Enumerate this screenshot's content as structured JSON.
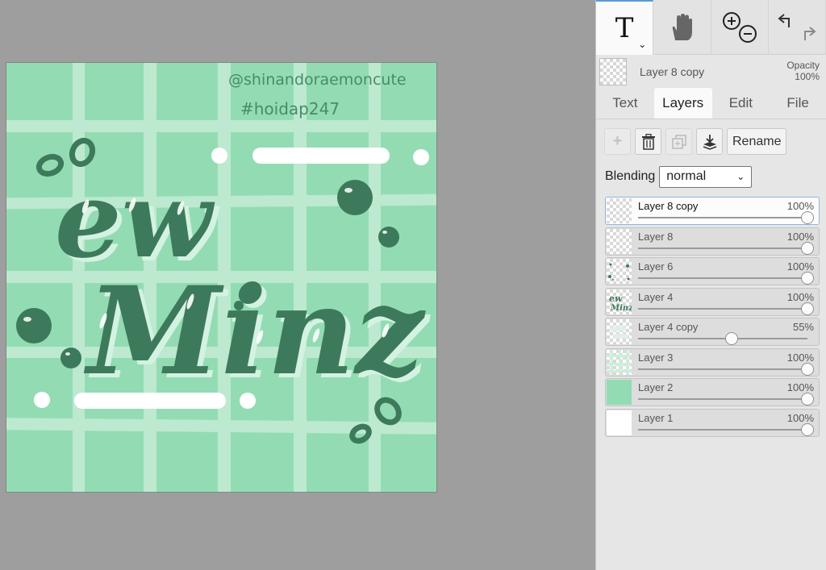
{
  "canvas": {
    "watermark_user": "@shinandoraemoncute",
    "watermark_tag": "#hoidap247",
    "artwork_line1": "ew",
    "artwork_line2": "Minz",
    "colors": {
      "background": "#93dcb3",
      "stripes": "#bfead1",
      "lettering": "#3d7a5b",
      "dots": "#ffffff"
    }
  },
  "toolbar": {
    "tools": [
      {
        "name": "text-tool",
        "label": "T",
        "active": true
      },
      {
        "name": "pan-tool",
        "icon": "hand-icon"
      },
      {
        "name": "zoom-tool",
        "icons": [
          "zoom-in-icon",
          "zoom-out-icon"
        ]
      },
      {
        "name": "history-tool",
        "icons": [
          "undo-icon",
          "redo-icon"
        ]
      }
    ]
  },
  "current_layer": {
    "name": "Layer 8 copy",
    "opacity_label": "Opacity",
    "opacity_value": "100%"
  },
  "tabs": [
    {
      "label": "Text",
      "active": false
    },
    {
      "label": "Layers",
      "active": true
    },
    {
      "label": "Edit",
      "active": false
    },
    {
      "label": "File",
      "active": false
    }
  ],
  "actions": {
    "add_icon": "plus-icon",
    "delete_icon": "trash-icon",
    "duplicate_icon": "duplicate-icon",
    "merge_icon": "merge-down-icon",
    "rename_label": "Rename"
  },
  "blending": {
    "label": "Blending",
    "value": "normal"
  },
  "layers": [
    {
      "name": "Layer 8 copy",
      "opacity": "100%",
      "opacity_fraction": 1.0,
      "selected": true,
      "thumb": "transparent"
    },
    {
      "name": "Layer 8",
      "opacity": "100%",
      "opacity_fraction": 1.0,
      "selected": false,
      "thumb": "transparent"
    },
    {
      "name": "Layer 6",
      "opacity": "100%",
      "opacity_fraction": 1.0,
      "selected": false,
      "thumb": "dots"
    },
    {
      "name": "Layer 4",
      "opacity": "100%",
      "opacity_fraction": 1.0,
      "selected": false,
      "thumb": "lettering"
    },
    {
      "name": "Layer 4 copy",
      "opacity": "55%",
      "opacity_fraction": 0.55,
      "selected": false,
      "thumb": "faint"
    },
    {
      "name": "Layer 3",
      "opacity": "100%",
      "opacity_fraction": 1.0,
      "selected": false,
      "thumb": "grid"
    },
    {
      "name": "Layer 2",
      "opacity": "100%",
      "opacity_fraction": 1.0,
      "selected": false,
      "thumb": "green"
    },
    {
      "name": "Layer 1",
      "opacity": "100%",
      "opacity_fraction": 1.0,
      "selected": false,
      "thumb": "white"
    }
  ]
}
